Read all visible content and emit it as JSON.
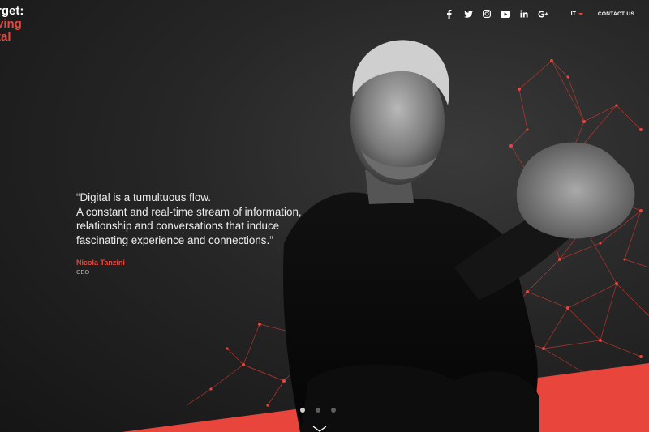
{
  "logo": {
    "line1": "rget:",
    "line2": "ving",
    "line3": "tal"
  },
  "nav": {
    "social": [
      "facebook",
      "twitter",
      "instagram",
      "youtube",
      "linkedin",
      "google-plus"
    ],
    "language": "IT",
    "contact_label": "CONTACT US"
  },
  "quote": {
    "line1": "“Digital is a tumultuous flow.",
    "line2": "A constant and real-time stream of information,",
    "line3": "relationship and conversations that induce",
    "line4": "fascinating experience and connections.”"
  },
  "author": {
    "name": "Nicola Tanzini",
    "role": "CEO"
  },
  "slider": {
    "count": 3,
    "active": 0
  },
  "colors": {
    "accent": "#e8453c",
    "background": "#1b1b1b",
    "text": "#ffffff"
  }
}
